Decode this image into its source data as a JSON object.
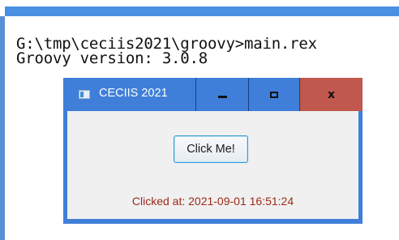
{
  "console": {
    "lines": {
      "command": "G:\\tmp\\ceciis2021\\groovy>main.rex",
      "version": "Groovy version: 3.0.8"
    }
  },
  "window": {
    "title": "CECIIS 2021",
    "controls": {
      "minimize_icon": "minimize-icon",
      "maximize_icon": "maximize-icon",
      "close_icon": "close-icon",
      "close_label": "x"
    },
    "button_label": "Click Me!",
    "status_text": "Clicked at: 2021-09-01 16:51:24"
  },
  "colors": {
    "titlebar": "#3f7fd9",
    "close_button": "#c0584d",
    "status_text": "#9a2a16",
    "button_border": "#2e9bd6",
    "console_accent": "#4a90e2"
  }
}
